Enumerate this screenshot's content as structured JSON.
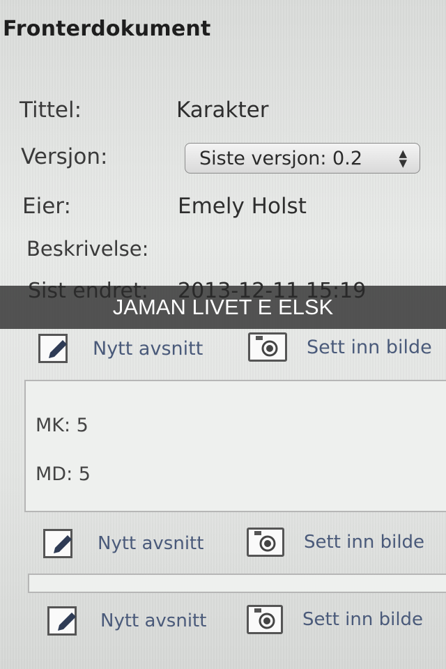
{
  "document": {
    "heading": "Fronterdokument",
    "title_label": "Tittel:",
    "title_value": "Karakter",
    "version_label": "Versjon:",
    "version_selected": "Siste versjon: 0.2",
    "owner_label": "Eier:",
    "owner_value": "Emely Holst",
    "description_label": "Beskrivelse:",
    "modified_label": "Sist endret:",
    "modified_value": "2013-12-11 15:19"
  },
  "overlay": {
    "caption": "JAMAN LIVET E ELSK"
  },
  "toolbars": [
    {
      "new_paragraph": "Nytt avsnitt",
      "insert_image": "Sett inn bilde"
    },
    {
      "new_paragraph": "Nytt avsnitt",
      "insert_image": "Sett inn bilde"
    },
    {
      "new_paragraph": "Nytt avsnitt",
      "insert_image": "Sett inn bilde"
    }
  ],
  "content": {
    "lines": [
      "MK: 5",
      "MD: 5"
    ]
  },
  "icons": {
    "new_paragraph": "pencil-edit-icon",
    "insert_image": "camera-icon"
  },
  "colors": {
    "link_text": "#4a5a7a",
    "banner_bg": "#282828"
  }
}
